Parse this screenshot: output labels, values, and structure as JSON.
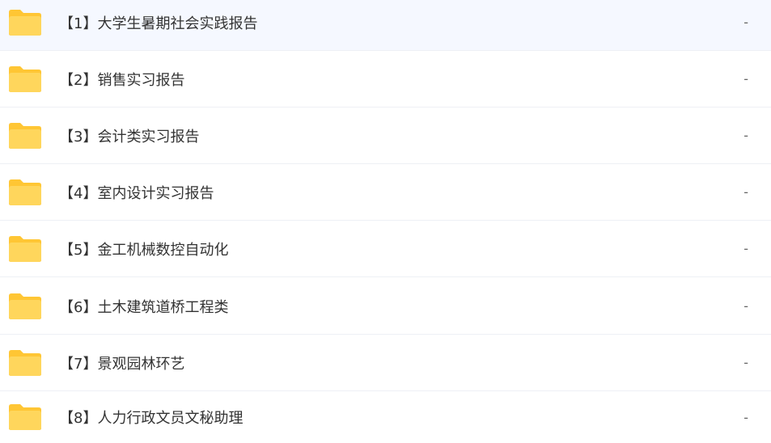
{
  "icons": {
    "folder": "folder-icon"
  },
  "colors": {
    "folder_body": "#ffd65c",
    "folder_tab": "#ffc634",
    "row_divider": "#eef0f5",
    "text": "#333333"
  },
  "files": [
    {
      "name": "【1】大学生暑期社会实践报告",
      "size": "-"
    },
    {
      "name": "【2】销售实习报告",
      "size": "-"
    },
    {
      "name": "【3】会计类实习报告",
      "size": "-"
    },
    {
      "name": "【4】室内设计实习报告",
      "size": "-"
    },
    {
      "name": "【5】金工机械数控自动化",
      "size": "-"
    },
    {
      "name": "【6】土木建筑道桥工程类",
      "size": "-"
    },
    {
      "name": "【7】景观园林环艺",
      "size": "-"
    },
    {
      "name": "【8】人力行政文员文秘助理",
      "size": "-"
    }
  ]
}
